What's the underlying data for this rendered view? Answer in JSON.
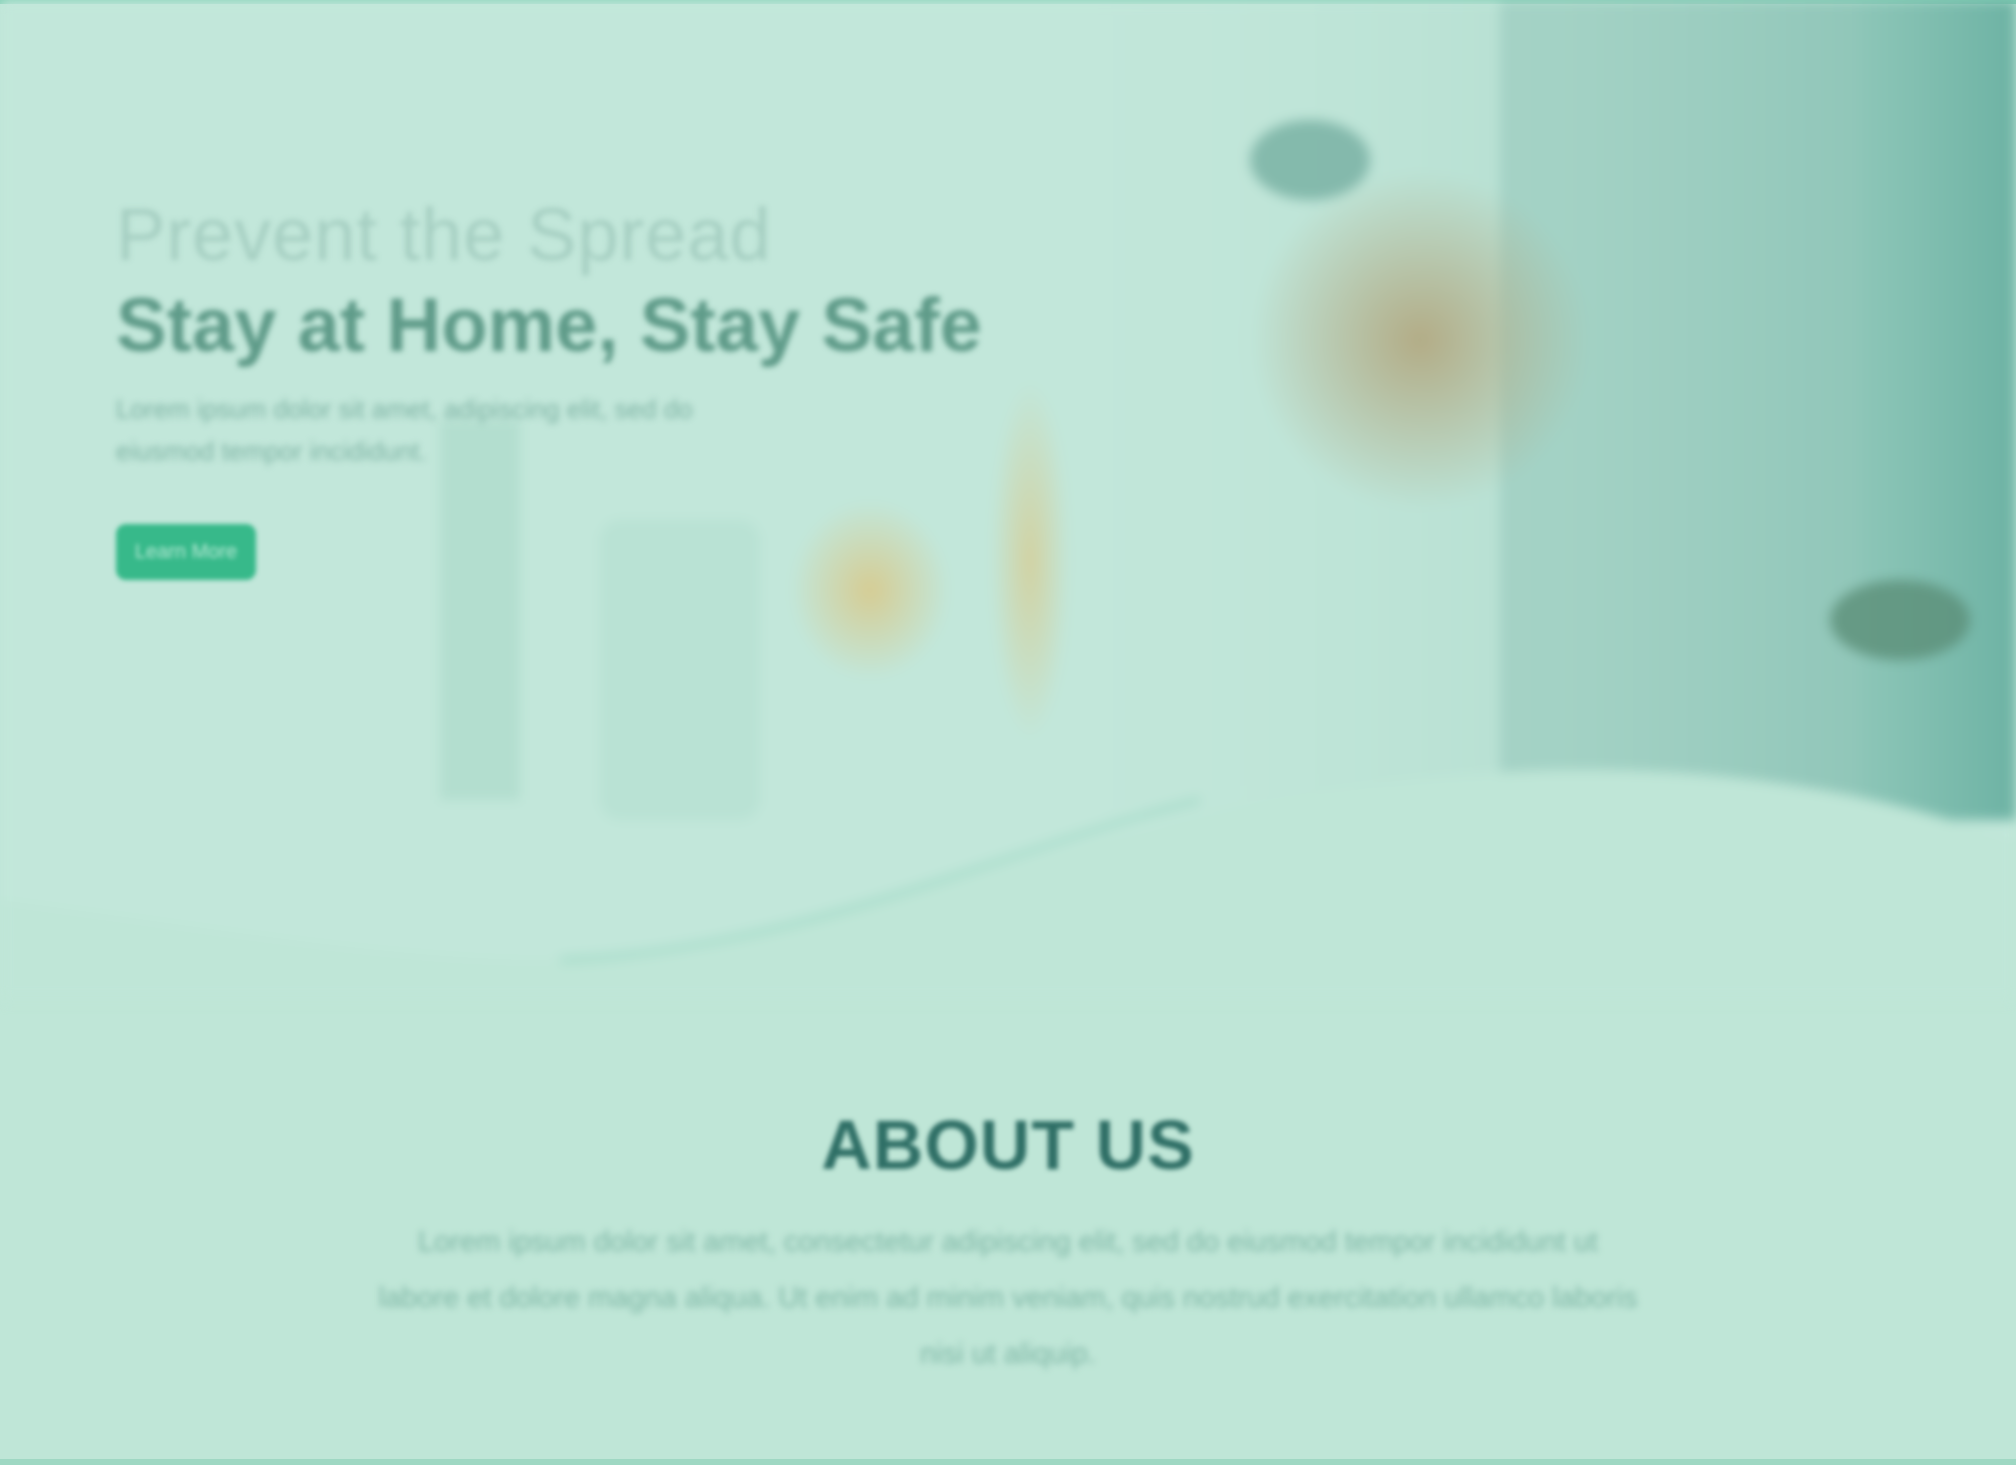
{
  "hero": {
    "line1": "Prevent the Spread",
    "line2": "Stay at Home, Stay Safe",
    "description": "Lorem ipsum dolor sit amet, adipiscing elit, sed do eiusmod tempor incididunt.",
    "cta_label": "Learn More"
  },
  "about": {
    "title": "ABOUT US",
    "body": "Lorem ipsum dolor sit amet, consectetur adipiscing elit, sed do eiusmod tempor incididunt ut labore et dolore magna aliqua. Ut enim ad minim veniam, quis nostrud exercitation ullamco laboris nisi ut aliquip."
  },
  "colors": {
    "background": "#bfe6d7",
    "accent": "#37b98a",
    "heading_dark": "#2f6f66"
  }
}
